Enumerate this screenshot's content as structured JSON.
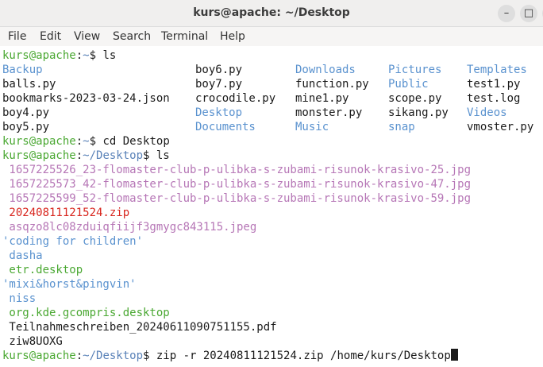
{
  "window": {
    "title": "kurs@apache: ~/Desktop",
    "buttons": {
      "minimize": "–",
      "maximize": "□",
      "close": "✕"
    }
  },
  "menu": [
    "File",
    "Edit",
    "View",
    "Search",
    "Terminal",
    "Help"
  ],
  "prompt": {
    "user_host": "kurs@apache",
    "colon": ":",
    "home": "~",
    "desktop": "~/Desktop",
    "dollar": "$"
  },
  "commands": {
    "ls1": " ls",
    "cd": " cd Desktop",
    "ls2": " ls",
    "zip": " zip -r 20240811121524.zip /home/kurs/Desktop"
  },
  "home_listing": [
    [
      "Backup",
      "boy6.py",
      "Downloads",
      "Pictures",
      "Templates"
    ],
    [
      "balls.py",
      "boy7.py",
      "function.py",
      "Public",
      "test1.py"
    ],
    [
      "bookmarks-2023-03-24.json",
      "crocodile.py",
      "mine1.py",
      "scope.py",
      "test.log"
    ],
    [
      "boy4.py",
      "Desktop",
      "monster.py",
      "sikang.py",
      "Videos"
    ],
    [
      "boy5.py",
      "Documents",
      "Music",
      "snap",
      "vmoster.py"
    ]
  ],
  "desktop_listing": [
    " 1657225526_23-flomaster-club-p-ulibka-s-zubami-risunok-krasivo-25.jpg",
    " 1657225573_42-flomaster-club-p-ulibka-s-zubami-risunok-krasivo-47.jpg",
    " 1657225599_52-flomaster-club-p-ulibka-s-zubami-risunok-krasivo-59.jpg",
    " 20240811121524.zip",
    " asqzo8lc08zduiqfiijf3gmygc843115.jpeg",
    "'coding for children'",
    " dasha",
    " etr.desktop",
    "'mixi&horst&pingvin'",
    " niss",
    " org.kde.gcompris.desktop",
    " Teilnahmeschreiben_20240611090751155.pdf",
    " ziw8UOXG"
  ],
  "colors": {
    "prompt_user": "#4aa832",
    "prompt_path": "#5a82b8",
    "directory": "#5a92cf",
    "image": "#b676b6",
    "archive": "#d8261e"
  }
}
